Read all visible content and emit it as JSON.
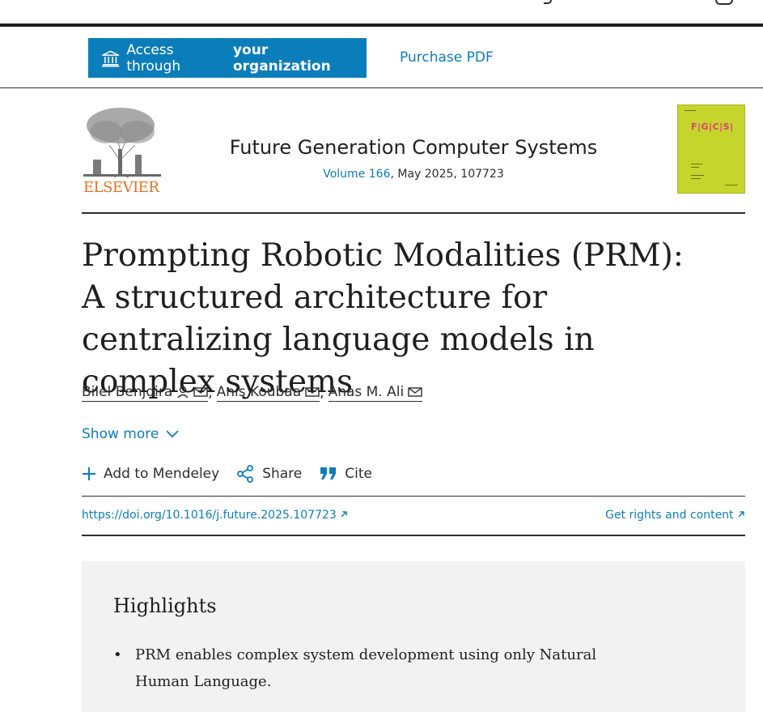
{
  "access": {
    "button_prefix": "Access through",
    "button_bold": "your organization",
    "purchase_label": "Purchase PDF"
  },
  "journal": {
    "publisher": "ELSEVIER",
    "title": "Future Generation Computer Systems",
    "volume": "Volume 166",
    "issue_rest": ", May 2025, 107723",
    "cover_text": "F|G|C|S|"
  },
  "article": {
    "title": "Prompting Robotic Modalities (PRM): A structured architecture for centralizing language models in complex systems",
    "authors": [
      {
        "name": "Bilel Benjdira"
      },
      {
        "name": "Anis Koubaa"
      },
      {
        "name": "Anas M. Ali"
      }
    ],
    "show_more": "Show more",
    "doi": "https://doi.org/10.1016/j.future.2025.107723",
    "rights": "Get rights and content"
  },
  "actions": {
    "mendeley": "Add to Mendeley",
    "share": "Share",
    "cite": "Cite"
  },
  "highlights": {
    "heading": "Highlights",
    "items": [
      "PRM enables complex system development using only Natural Human Language."
    ]
  },
  "colors": {
    "accent": "#0c7dbb",
    "publisher": "#e9711c",
    "cover": "#c6d52c",
    "panel": "#f2f2f2"
  }
}
